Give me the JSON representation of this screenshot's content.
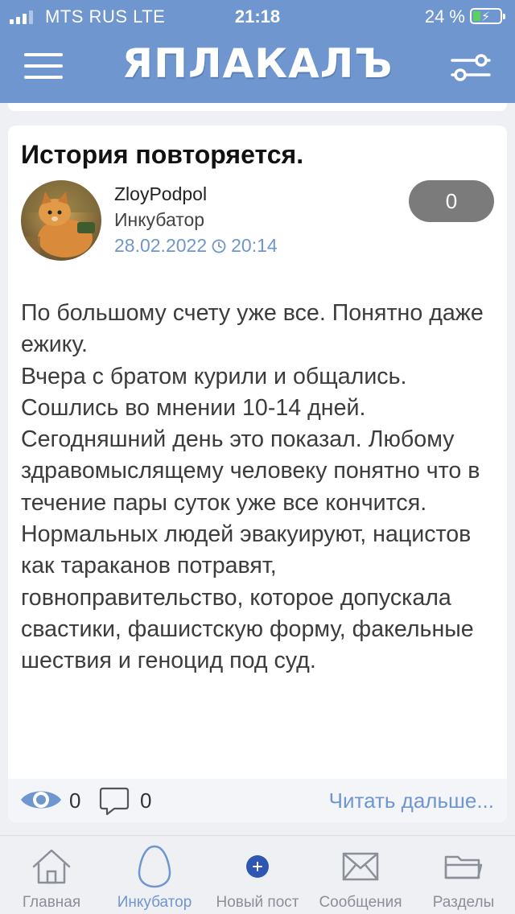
{
  "status_bar": {
    "carrier": "MTS RUS  LTE",
    "time": "21:18",
    "battery": "24 %"
  },
  "header": {
    "logo": "ЯПЛАКАЛЪ",
    "menu_icon": "hamburger-menu-icon",
    "settings_icon": "sliders-settings-icon"
  },
  "post": {
    "title": "История повторяется.",
    "author": "ZloyPodpol",
    "section": "Инкубатор",
    "date": "28.02.2022",
    "time": "20:14",
    "rating": "0",
    "body": "По большому счету уже все. Понятно даже ежику.\nВчера с братом курили и общались. Сошлись во мнении 10-14 дней. Сегодняшний день это показал. Любому здравомыслящему человеку понятно что в течение пары суток уже все кончится.\nНормальных людей эвакуируют, нацистов как тараканов потравят, говноправительство, которое допускала свастики, фашистскую форму, факельные шествия и геноцид под суд.",
    "views": "0",
    "comments": "0",
    "read_more": "Читать дальше..."
  },
  "tabs": [
    {
      "label": "Главная",
      "icon": "home-icon"
    },
    {
      "label": "Инкубатор",
      "icon": "egg-icon"
    },
    {
      "label": "Новый пост",
      "icon": "plus-circle-icon"
    },
    {
      "label": "Сообщения",
      "icon": "envelope-icon"
    },
    {
      "label": "Разделы",
      "icon": "folder-icon"
    }
  ],
  "colors": {
    "accent": "#6f96cf",
    "rating_bg": "#7b7b7b"
  }
}
